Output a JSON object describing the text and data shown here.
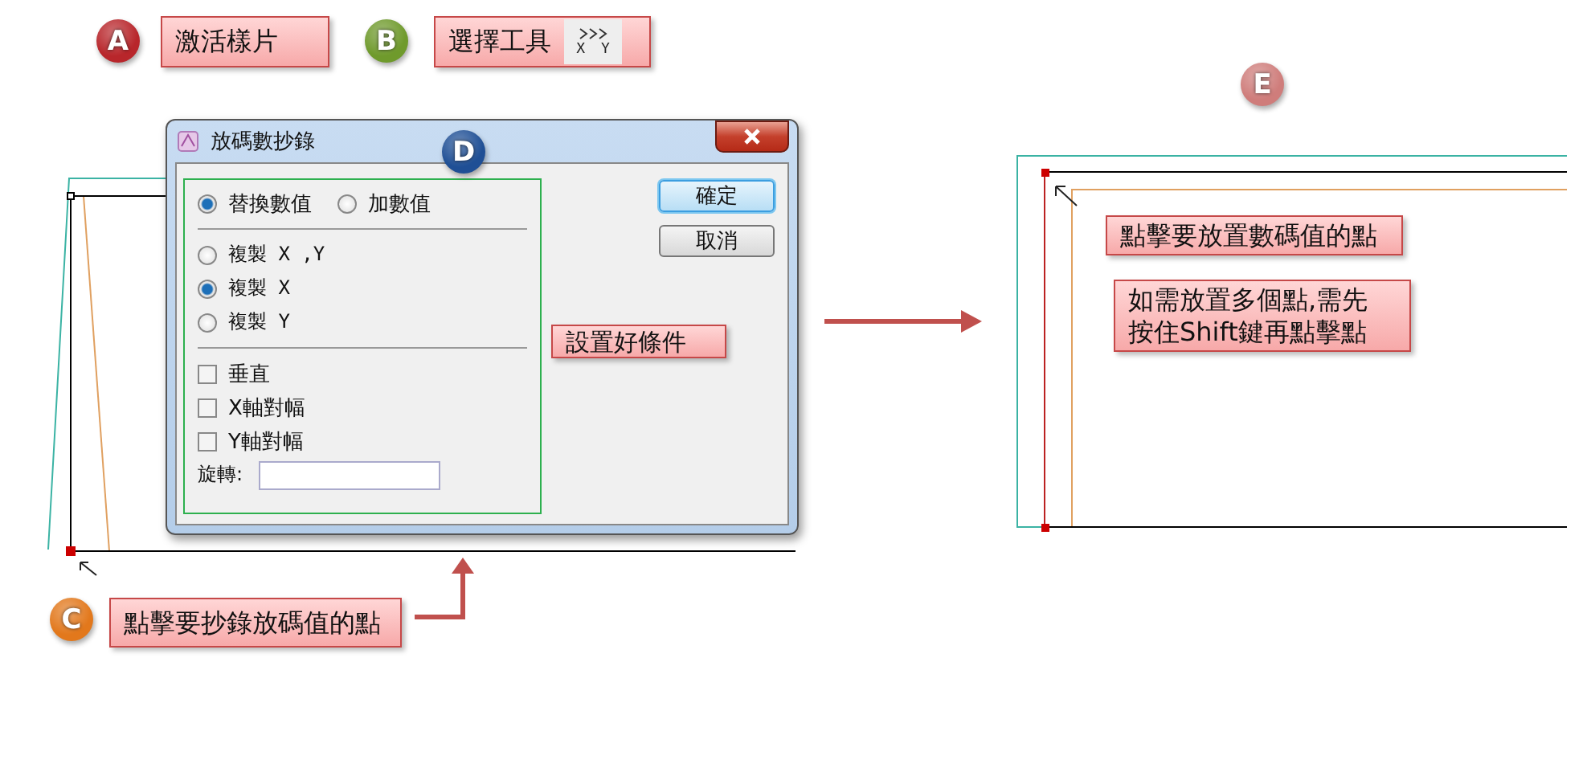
{
  "badges": [
    {
      "letter": "A",
      "color": "#b8262b"
    },
    {
      "letter": "B",
      "color": "#6f9a2c"
    },
    {
      "letter": "C",
      "color": "#e2781c"
    },
    {
      "letter": "D",
      "color": "#1f4f95"
    },
    {
      "letter": "E",
      "color": "#cf7d7b"
    }
  ],
  "callouts": [
    {
      "lines": [
        "激活樣片"
      ]
    },
    {
      "lines": [
        "選擇工具"
      ],
      "tool_labels": [
        "X",
        "Y"
      ]
    },
    {
      "lines": [
        "設置好條件"
      ]
    },
    {
      "lines": [
        "點擊要抄錄放碼值的點"
      ]
    },
    {
      "lines": [
        "點擊要放置數碼值的點"
      ]
    },
    {
      "lines": [
        "如需放置多個點,需先",
        "按住Shift鍵再點擊點"
      ]
    }
  ],
  "dialog": {
    "title": "放碼數抄錄",
    "mode_options": [
      {
        "label": "替換數值",
        "selected": true
      },
      {
        "label": "加數值",
        "selected": false
      }
    ],
    "copy_options": [
      {
        "label": "複製 X ,Y",
        "selected": false
      },
      {
        "label": "複製 X",
        "selected": true
      },
      {
        "label": "複製 Y",
        "selected": false
      }
    ],
    "checkboxes": [
      {
        "label": "垂直",
        "checked": false
      },
      {
        "label": "X軸對幅",
        "checked": false
      },
      {
        "label": "Y軸對幅",
        "checked": false
      }
    ],
    "rotate": {
      "label": "旋轉:"
    },
    "buttons": [
      {
        "label": "確定",
        "default": true
      },
      {
        "label": "取消",
        "default": false
      }
    ]
  }
}
